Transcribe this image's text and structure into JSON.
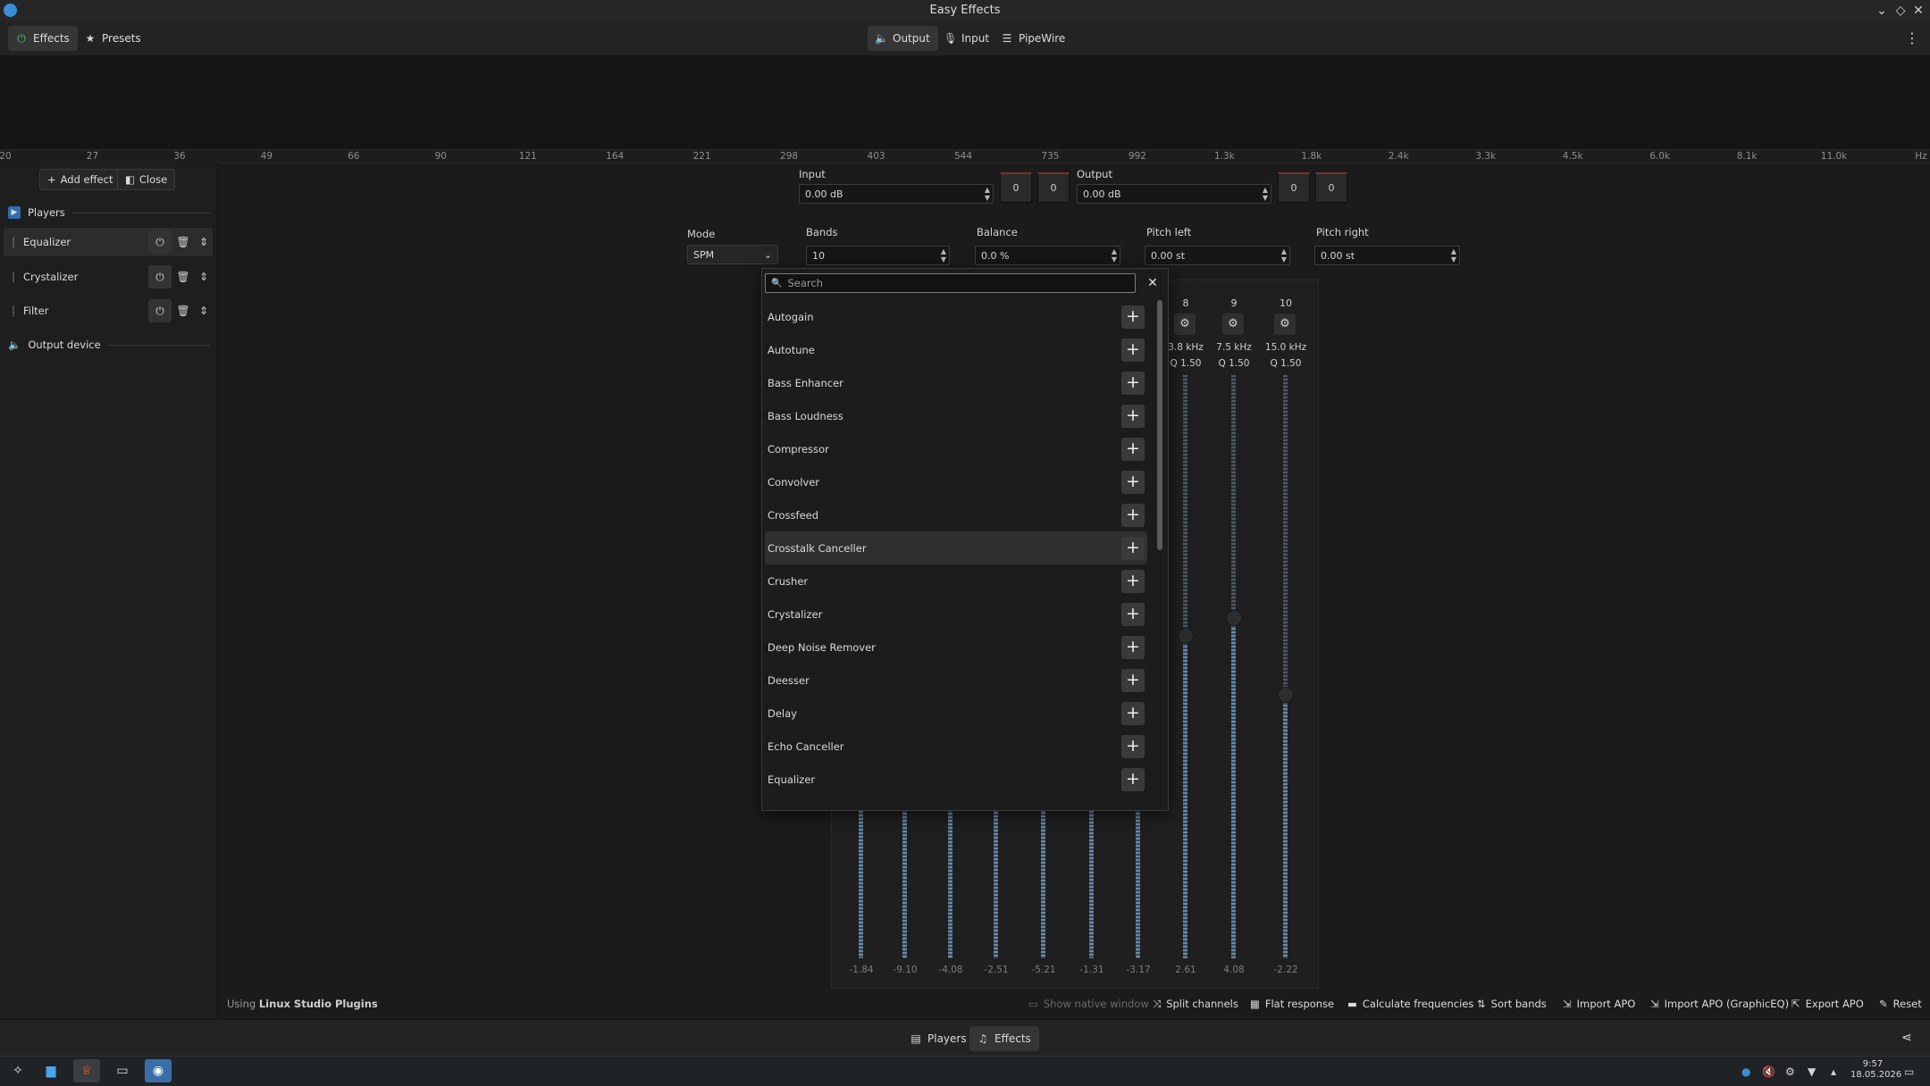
{
  "window": {
    "title": "Easy Effects",
    "controls": [
      "minimize-icon",
      "maximize-icon",
      "close-icon"
    ]
  },
  "toolbar": {
    "effects": "Effects",
    "presets": "Presets",
    "output": "Output",
    "input": "Input",
    "pipewire": "PipeWire"
  },
  "frequency_axis": [
    "20",
    "27",
    "36",
    "49",
    "66",
    "90",
    "121",
    "164",
    "221",
    "298",
    "403",
    "544",
    "735",
    "992",
    "1.3k",
    "1.8k",
    "2.4k",
    "3.3k",
    "4.5k",
    "6.0k",
    "8.1k",
    "11.0k",
    "Hz"
  ],
  "sidebar": {
    "add_effect": "Add effect",
    "close": "Close",
    "players_section": "Players",
    "effects": [
      {
        "name": "Equalizer",
        "selected": true
      },
      {
        "name": "Crystalizer",
        "selected": false
      },
      {
        "name": "Filter",
        "selected": false
      }
    ],
    "output_device": "Output device"
  },
  "levels": {
    "input_label": "Input",
    "input_value": "0.00 dB",
    "input_meters": [
      "0",
      "0"
    ],
    "output_label": "Output",
    "output_value": "0.00 dB",
    "output_meters": [
      "0",
      "0"
    ]
  },
  "eq_settings": {
    "mode_label": "Mode",
    "mode_value": "SPM",
    "bands_label": "Bands",
    "bands_value": "10",
    "balance_label": "Balance",
    "balance_value": "0.0 %",
    "pitch_left_label": "Pitch left",
    "pitch_left_value": "0.00 st",
    "pitch_right_label": "Pitch right",
    "pitch_right_value": "0.00 st"
  },
  "bands_visible": [
    {
      "num": "8",
      "freq": "3.8 kHz",
      "q": "Q 1.50",
      "gain": "2.61"
    },
    {
      "num": "9",
      "freq": "7.5 kHz",
      "q": "Q 1.50",
      "gain": "4.08"
    },
    {
      "num": "10",
      "freq": "15.0 kHz",
      "q": "Q 1.50",
      "gain": "-2.22"
    }
  ],
  "band_gains_hidden": [
    "-1.84",
    "-9.10",
    "-4.08",
    "-2.51",
    "-5.21",
    "-1.31",
    "-3.17"
  ],
  "add_effect_popup": {
    "search_placeholder": "Search",
    "items": [
      "Autogain",
      "Autotune",
      "Bass Enhancer",
      "Bass Loudness",
      "Compressor",
      "Convolver",
      "Crossfeed",
      "Crosstalk Canceller",
      "Crusher",
      "Crystalizer",
      "Deep Noise Remover",
      "Deesser",
      "Delay",
      "Echo Canceller",
      "Equalizer"
    ],
    "highlighted": "Crosstalk Canceller"
  },
  "status": {
    "using_prefix": "Using",
    "plugin_name": "Linux Studio Plugins"
  },
  "bottom_actions": {
    "show_native": "Show native window",
    "split_channels": "Split channels",
    "flat_response": "Flat response",
    "calculate_frequencies": "Calculate frequencies",
    "sort_bands": "Sort bands",
    "import_apo": "Import APO",
    "import_apo_graphic": "Import APO (GraphicEQ)",
    "export_apo": "Export APO",
    "reset": "Reset"
  },
  "viewbar": {
    "players": "Players",
    "effects": "Effects"
  },
  "taskbar": {
    "time": "9:57",
    "date": "18.05.2026"
  },
  "colors": {
    "accent": "#3a8ed8",
    "meter_peak": "#7e2e2e",
    "background": "#1b1b1b"
  }
}
